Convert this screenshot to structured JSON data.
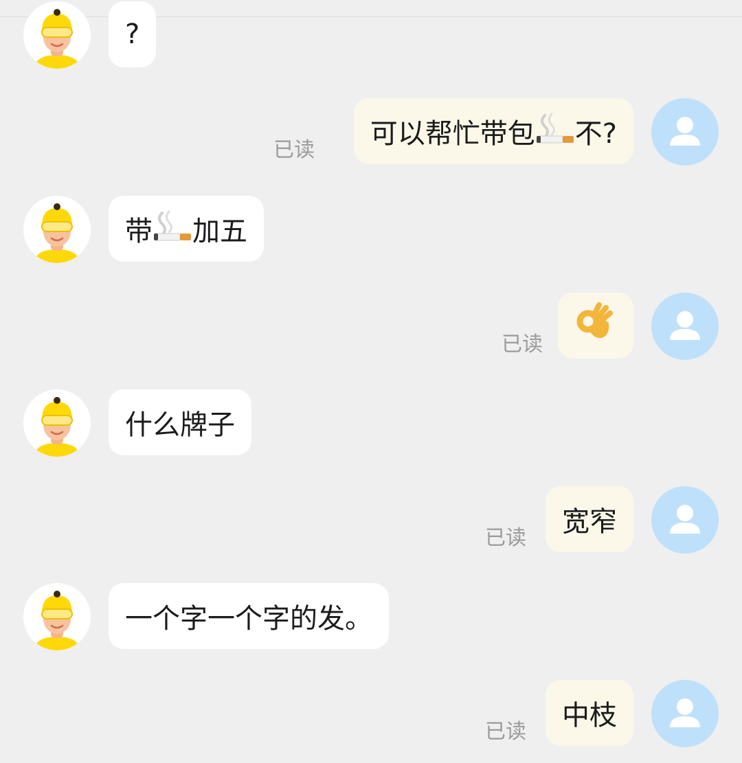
{
  "messages": [
    {
      "side": "left",
      "text": "?"
    },
    {
      "side": "right",
      "parts": [
        "可以帮忙带包",
        "cigarette",
        "不?"
      ],
      "status": "已读"
    },
    {
      "side": "left",
      "parts": [
        "带",
        "cigarette",
        "加五"
      ]
    },
    {
      "side": "right",
      "parts": [
        "ok-hand"
      ],
      "status": "已读"
    },
    {
      "side": "left",
      "text": "什么牌子"
    },
    {
      "side": "right",
      "text": "宽窄",
      "status": "已读"
    },
    {
      "side": "left",
      "text": "一个字一个字的发。"
    },
    {
      "side": "right",
      "text": "中枝",
      "status": "已读"
    }
  ],
  "icons": {
    "courier_avatar": "courier-avatar-icon",
    "user_avatar": "person-icon",
    "emoji_cigarette": "cigarette-emoji",
    "emoji_ok": "ok-hand-emoji"
  },
  "colors": {
    "background": "#efefef",
    "incoming_bubble": "#ffffff",
    "outgoing_bubble": "#fbf8ea",
    "user_avatar_bg": "#bfe0fb",
    "read_status": "#9b9b9b",
    "helmet_yellow": "#ffd80a"
  }
}
